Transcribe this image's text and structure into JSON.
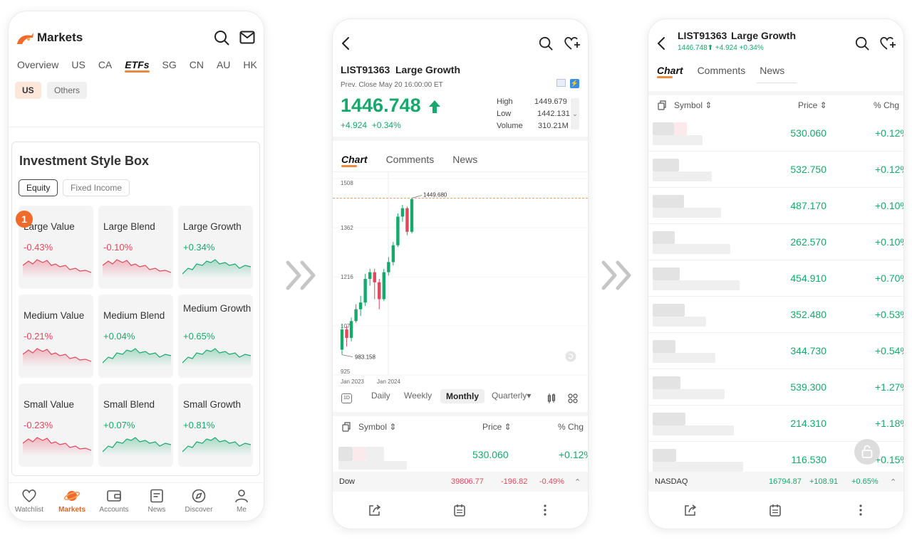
{
  "screen1": {
    "title": "Markets",
    "tabs": [
      "Overview",
      "US",
      "CA",
      "ETFs",
      "SG",
      "CN",
      "AU",
      "HK"
    ],
    "active_tab": "ETFs",
    "sub_tabs": [
      "US",
      "Others"
    ],
    "style_box": {
      "title": "Investment Style Box",
      "segments": [
        "Equity",
        "Fixed Income"
      ],
      "badge": "1",
      "cells": [
        {
          "name": "Large Value",
          "change": "-0.43%",
          "trend": "down"
        },
        {
          "name": "Large Blend",
          "change": "-0.10%",
          "trend": "down"
        },
        {
          "name": "Large Growth",
          "change": "+0.34%",
          "trend": "up"
        },
        {
          "name": "Medium Value",
          "change": "-0.21%",
          "trend": "down"
        },
        {
          "name": "Medium Blend",
          "change": "+0.04%",
          "trend": "up"
        },
        {
          "name": "Medium Growth",
          "change": "+0.65%",
          "trend": "up"
        },
        {
          "name": "Small Value",
          "change": "-0.23%",
          "trend": "down"
        },
        {
          "name": "Small Blend",
          "change": "+0.07%",
          "trend": "up"
        },
        {
          "name": "Small Growth",
          "change": "+0.81%",
          "trend": "up"
        }
      ]
    },
    "nav": [
      {
        "label": "Watchlist",
        "icon": "heart-icon"
      },
      {
        "label": "Markets",
        "icon": "planet-icon"
      },
      {
        "label": "Accounts",
        "icon": "wallet-icon"
      },
      {
        "label": "News",
        "icon": "news-icon"
      },
      {
        "label": "Discover",
        "icon": "compass-icon"
      },
      {
        "label": "Me",
        "icon": "person-icon"
      }
    ]
  },
  "screen2": {
    "symbol": "LIST91363",
    "name": "Large Growth",
    "prev_close": "Prev. Close May 20 16:00:00 ET",
    "price": "1446.748",
    "change": "+4.924",
    "change_pct": "+0.34%",
    "stats": [
      {
        "label": "High",
        "value": "1449.679"
      },
      {
        "label": "Low",
        "value": "1442.131"
      },
      {
        "label": "Volume",
        "value": "310.21M"
      }
    ],
    "tabs": [
      "Chart",
      "Comments",
      "News"
    ],
    "periods": [
      "Daily",
      "Weekly",
      "Monthly",
      "Quarterly▾"
    ],
    "period_1d": "1D",
    "active_period": "Monthly",
    "table_head": {
      "symbol": "Symbol",
      "price": "Price",
      "chg": "% Chg"
    },
    "first_row": {
      "price": "530.060",
      "chg": "+0.12%"
    },
    "index": {
      "name": "Dow",
      "value": "39806.77",
      "change": "-196.82",
      "pct": "-0.49%"
    }
  },
  "chart_data": {
    "type": "candlestick",
    "title": "",
    "y_ticks": [
      "1508",
      "1362",
      "1216",
      "1071",
      "925"
    ],
    "x_ticks": [
      "Jan 2023",
      "Jan 2024"
    ],
    "ylim": [
      925,
      1508
    ],
    "annotations": {
      "high_label": "1449.680",
      "low_label": "983.158"
    },
    "candles": [
      {
        "o": 1000,
        "c": 1060,
        "h": 1075,
        "l": 985,
        "up": true
      },
      {
        "o": 1060,
        "c": 1035,
        "h": 1070,
        "l": 1010,
        "up": false
      },
      {
        "o": 1035,
        "c": 1085,
        "h": 1095,
        "l": 1025,
        "up": true
      },
      {
        "o": 1085,
        "c": 1120,
        "h": 1135,
        "l": 1080,
        "up": true
      },
      {
        "o": 1120,
        "c": 1140,
        "h": 1160,
        "l": 1100,
        "up": true
      },
      {
        "o": 1140,
        "c": 1210,
        "h": 1225,
        "l": 1130,
        "up": true
      },
      {
        "o": 1210,
        "c": 1230,
        "h": 1240,
        "l": 1190,
        "up": true
      },
      {
        "o": 1230,
        "c": 1200,
        "h": 1240,
        "l": 1150,
        "up": false
      },
      {
        "o": 1200,
        "c": 1150,
        "h": 1210,
        "l": 1120,
        "up": false
      },
      {
        "o": 1150,
        "c": 1230,
        "h": 1240,
        "l": 1145,
        "up": true
      },
      {
        "o": 1230,
        "c": 1260,
        "h": 1275,
        "l": 1220,
        "up": true
      },
      {
        "o": 1260,
        "c": 1310,
        "h": 1320,
        "l": 1250,
        "up": true
      },
      {
        "o": 1310,
        "c": 1395,
        "h": 1405,
        "l": 1305,
        "up": true
      },
      {
        "o": 1395,
        "c": 1420,
        "h": 1430,
        "l": 1380,
        "up": true
      },
      {
        "o": 1420,
        "c": 1350,
        "h": 1425,
        "l": 1340,
        "up": false
      },
      {
        "o": 1350,
        "c": 1447,
        "h": 1450,
        "l": 1345,
        "up": true
      }
    ]
  },
  "screen3": {
    "symbol": "LIST91363",
    "name": "Large Growth",
    "price_line": "1446.748",
    "change": "+4.924",
    "change_pct": "+0.34%",
    "tabs": [
      "Chart",
      "Comments",
      "News"
    ],
    "table_head": {
      "symbol": "Symbol",
      "price": "Price",
      "chg": "% Chg"
    },
    "rows": [
      {
        "price": "530.060",
        "chg": "+0.12%"
      },
      {
        "price": "532.750",
        "chg": "+0.12%"
      },
      {
        "price": "487.170",
        "chg": "+0.10%"
      },
      {
        "price": "262.570",
        "chg": "+0.10%"
      },
      {
        "price": "454.910",
        "chg": "+0.70%"
      },
      {
        "price": "352.480",
        "chg": "+0.53%"
      },
      {
        "price": "344.730",
        "chg": "+0.54%"
      },
      {
        "price": "539.300",
        "chg": "+1.27%"
      },
      {
        "price": "214.310",
        "chg": "+1.18%"
      },
      {
        "price": "116.530",
        "chg": "+0.15%"
      }
    ],
    "index": {
      "name": "NASDAQ",
      "value": "16794.87",
      "change": "+108.91",
      "pct": "+0.65%"
    }
  },
  "colors": {
    "green": "#17a86b",
    "red": "#e2475b",
    "accent": "#f08a3c"
  }
}
